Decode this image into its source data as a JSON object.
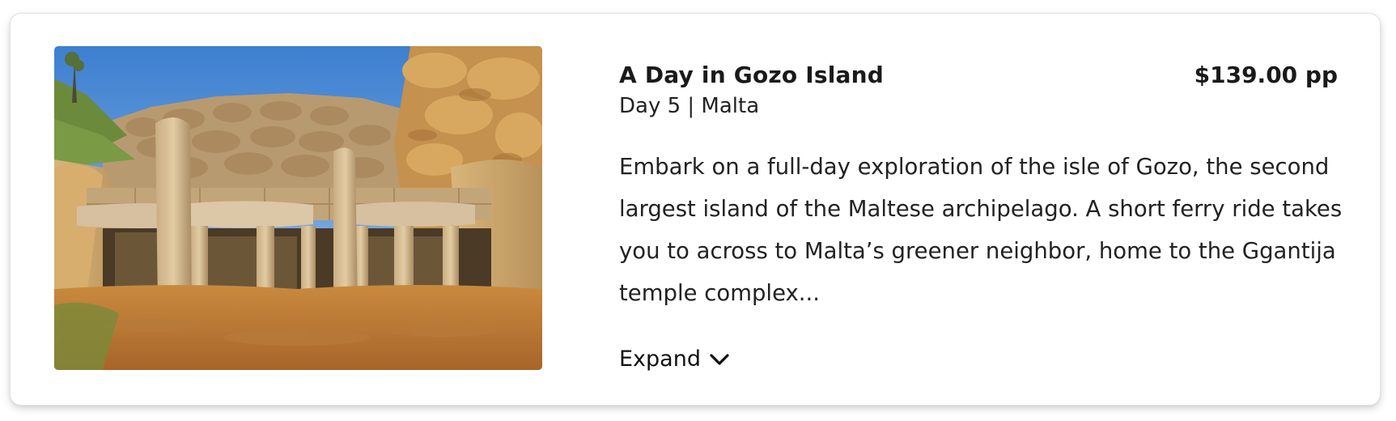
{
  "card": {
    "image": {
      "alt": "Ggantija temple ruins",
      "subject": "megalithic stone temple under blue sky"
    },
    "title": "A Day in Gozo Island",
    "subtitle": "Day 5 | Malta",
    "price": "$139.00 pp",
    "description": "Embark on a full-day exploration of the isle of Gozo, the second largest island of the Maltese archipelago. A short ferry ride takes you to across to Malta’s greener neighbor, home to the Ggantija temple complex...",
    "expand_label": "Expand",
    "expand_icon": "chevron-down-icon"
  },
  "colors": {
    "text": "#1a1a1a",
    "card_border": "#e2e2e2",
    "sky": "#4a86c9",
    "stone": "#c9a064"
  }
}
